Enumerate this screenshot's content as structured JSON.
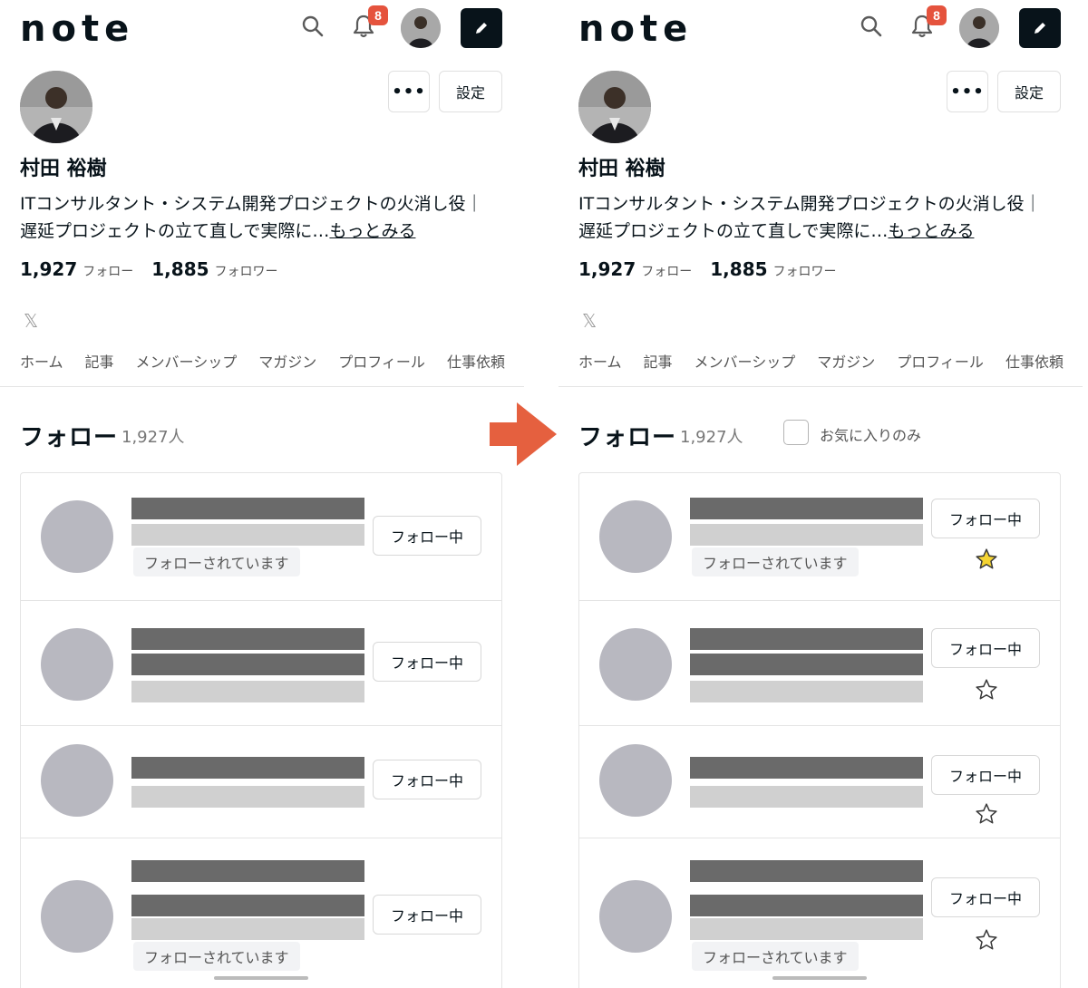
{
  "app": {
    "logo": "note",
    "notification_count": "8",
    "colors": {
      "accent_red": "#e5533d",
      "dark": "#08131a",
      "border": "#e4e4e4",
      "star_yellow": "#f5d432"
    }
  },
  "profile": {
    "settings_label": "設定",
    "more_label": "•••",
    "name": "村田 裕樹",
    "bio_line1": "ITコンサルタント・システム開発プロジェクトの火消し役｜",
    "bio_line2": "遅延プロジェクトの立て直しで実際に…",
    "bio_more": "もっとみる",
    "following_count": "1,927",
    "following_label": "フォロー",
    "followers_count": "1,885",
    "followers_label": "フォロワー",
    "x_icon": "𝕏"
  },
  "tabs": [
    "ホーム",
    "記事",
    "メンバーシップ",
    "マガジン",
    "プロフィール",
    "仕事依頼"
  ],
  "follow_section": {
    "title": "フォロー",
    "count": "1,927人",
    "favorites_only_label": "お気に入りのみ",
    "following_button": "フォロー中",
    "followed_by_badge": "フォローされています",
    "rows": [
      {
        "followed_by": true,
        "favorite": true
      },
      {
        "followed_by": false,
        "favorite": false
      },
      {
        "followed_by": false,
        "favorite": false
      },
      {
        "followed_by": true,
        "favorite": false
      }
    ]
  }
}
